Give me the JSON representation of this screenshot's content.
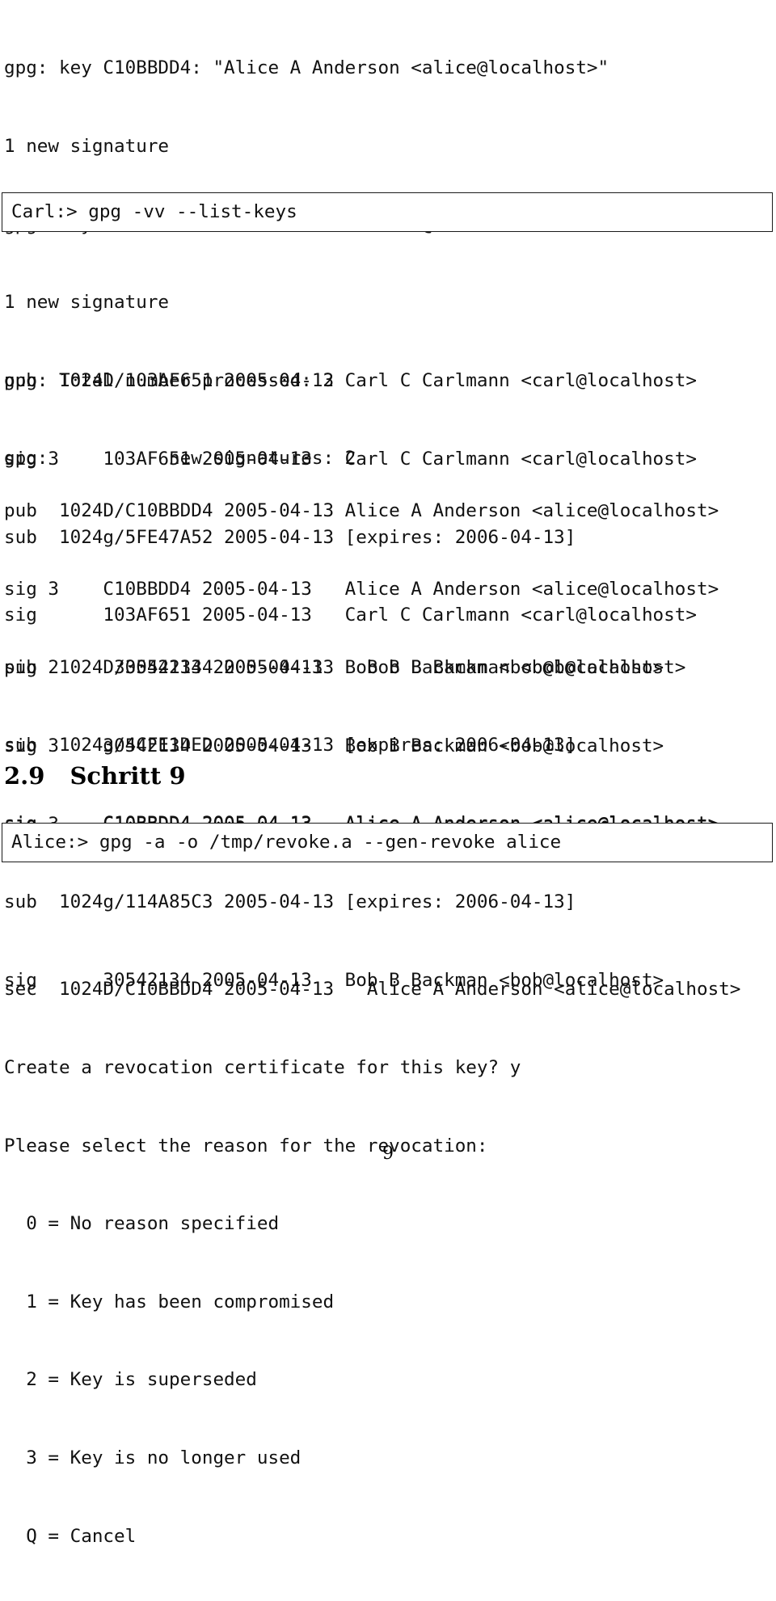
{
  "document": {
    "page_number": "9"
  },
  "import_output": {
    "lines": [
      "gpg: key C10BBDD4: \"Alice A Anderson <alice@localhost>\"",
      "1 new signature",
      "gpg: key 30542134: \"Bob B Backman <bob@localhost>\"",
      "1 new signature",
      "gpg: Total number processed: 2",
      "gpg:           new signatures: 2"
    ]
  },
  "command_list_keys": {
    "prompt": "Carl:>",
    "command": "gpg -vv --list-keys",
    "full_line": "Carl:> gpg -vv --list-keys"
  },
  "carl_key_block": {
    "lines": [
      "pub  1024D/103AF651 2005-04-13 Carl C Carlmann <carl@localhost>",
      "sig 3    103AF651 2005-04-13   Carl C Carlmann <carl@localhost>",
      "sub  1024g/5FE47A52 2005-04-13 [expires: 2006-04-13]",
      "sig      103AF651 2005-04-13   Carl C Carlmann <carl@localhost>"
    ]
  },
  "alice_key_block": {
    "lines": [
      "pub  1024D/C10BBDD4 2005-04-13 Alice A Anderson <alice@localhost>",
      "sig 3    C10BBDD4 2005-04-13   Alice A Anderson <alice@localhost>",
      "sig 2     30542134 2005-04-13    Bob B Backman <bob@localhost>",
      "sub  1024g/4CFE1DED 2005-04-13 [expires: 2006-04-13]",
      "sig      C10BBDD4 2005-04-13   Alice A Anderson <alice@localhost>"
    ]
  },
  "bob_key_block": {
    "lines": [
      "pub  1024D/30542134 2005-04-13 Bob B Backman <bob@localhost>",
      "sig 3    30542134 2005-04-13   Bob B Backman <bob@localhost>",
      "sig 3    C10BBDD4 2005-04-13   Alice A Anderson <alice@localhost>",
      "sub  1024g/114A85C3 2005-04-13 [expires: 2006-04-13]",
      "sig      30542134 2005-04-13   Bob B Backman <bob@localhost>"
    ]
  },
  "section": {
    "number": "2.9",
    "title": "Schritt 9"
  },
  "command_gen_revoke": {
    "prompt": "Alice:>",
    "command": "gpg -a -o /tmp/revoke.a --gen-revoke alice",
    "full_line": "Alice:> gpg -a -o /tmp/revoke.a --gen-revoke alice"
  },
  "revoke_output": {
    "lines": [
      "sec  1024D/C10BBDD4 2005-04-13   Alice A Anderson <alice@localhost>",
      "Create a revocation certificate for this key? y",
      "Please select the reason for the revocation:",
      "  0 = No reason specified",
      "  1 = Key has been compromised",
      "  2 = Key is superseded",
      "  3 = Key is no longer used",
      "  Q = Cancel"
    ]
  }
}
